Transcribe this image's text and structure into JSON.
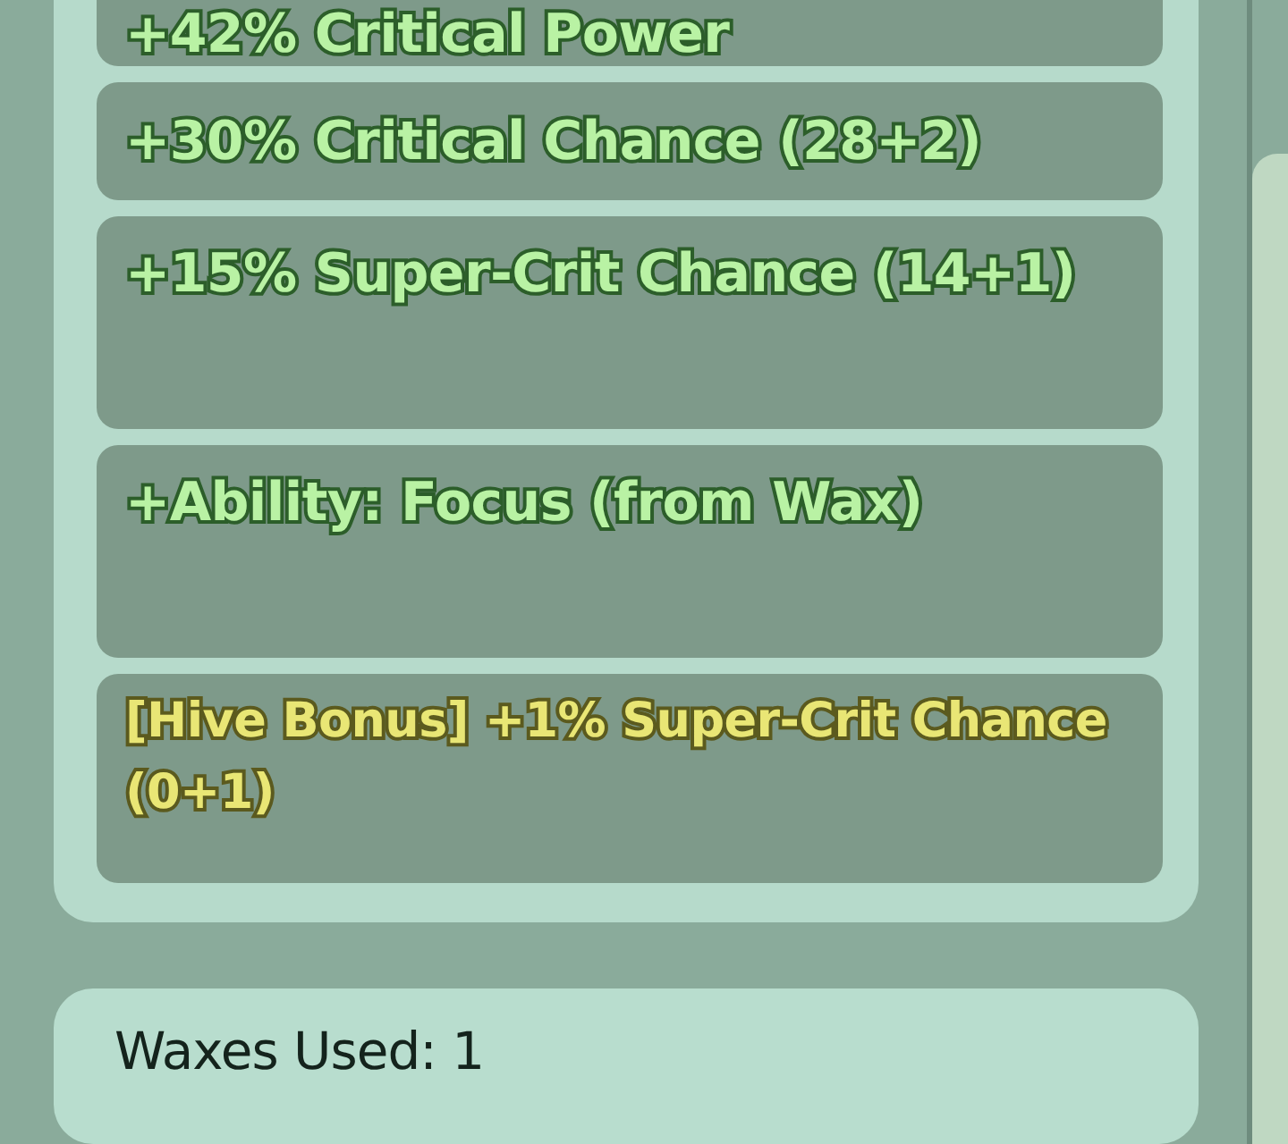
{
  "stats_panel": {
    "lines": [
      {
        "text": "+42% Critical Power",
        "kind": "stat"
      },
      {
        "text": "+30% Critical Chance (28+2)",
        "kind": "stat"
      },
      {
        "text": "+15% Super-Crit Chance (14+1)",
        "kind": "stat"
      },
      {
        "text": "+Ability: Focus (from Wax)",
        "kind": "stat"
      },
      {
        "text": "[Hive Bonus] +1% Super-Crit Chance (0+1)",
        "kind": "bonus"
      }
    ]
  },
  "waxes_panel": {
    "label": "Waxes Used: 1"
  }
}
